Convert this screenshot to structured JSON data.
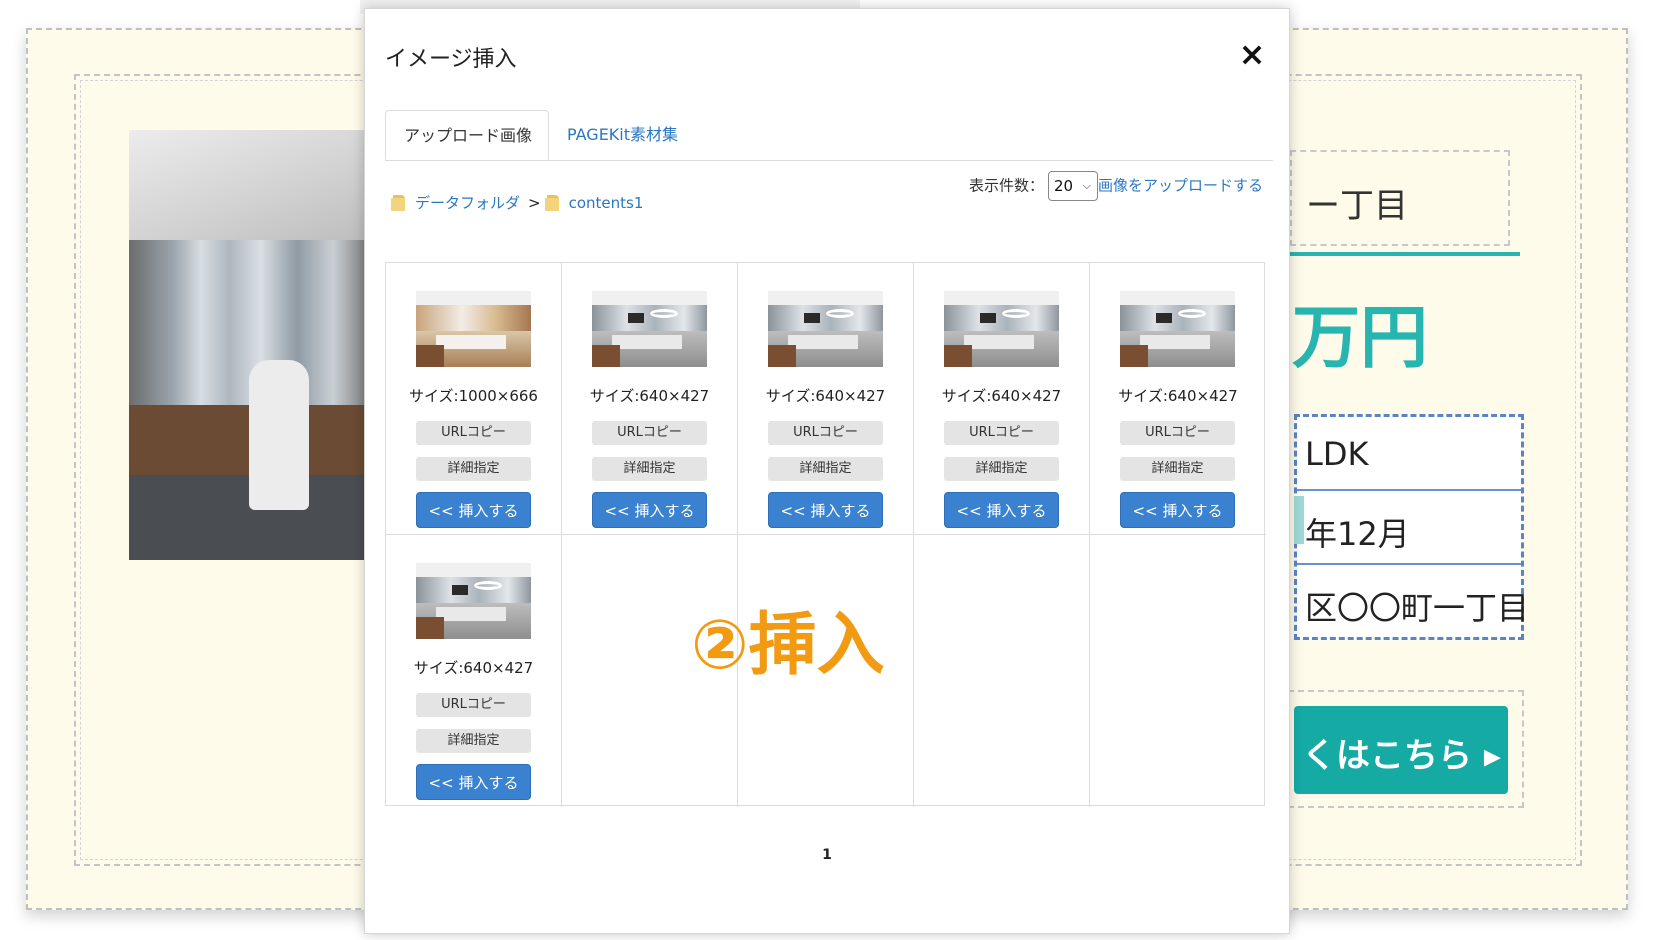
{
  "background_page": {
    "address_partial": "ー丁目",
    "price_partial": "万円",
    "table_rows": [
      "LDK",
      "年12月",
      "区〇〇町一丁目"
    ],
    "button_partial": "くはこちら ▸",
    "teal_color": "#15aaa4"
  },
  "modal": {
    "title": "イメージ挿入",
    "close_icon": "×",
    "tabs": [
      {
        "label": "アップロード画像",
        "active": true
      },
      {
        "label": "PAGEKit素材集",
        "active": false
      }
    ],
    "breadcrumb": {
      "root": "データフォルダ",
      "separator": ">",
      "current": "contents1"
    },
    "count_label": "表示件数：",
    "count_value": "20",
    "upload_link": "画像をアップロードする",
    "images": [
      {
        "size": "サイズ:1000×666",
        "kind": "kitchen"
      },
      {
        "size": "サイズ:640×427",
        "kind": "office"
      },
      {
        "size": "サイズ:640×427",
        "kind": "office"
      },
      {
        "size": "サイズ:640×427",
        "kind": "office"
      },
      {
        "size": "サイズ:640×427",
        "kind": "office"
      },
      {
        "size": "サイズ:640×427",
        "kind": "office"
      }
    ],
    "url_copy_label": "URLコピー",
    "detail_label": "詳細指定",
    "insert_label": "<< 挿入する",
    "page_number": "1"
  },
  "annotation": {
    "text": "②挿入",
    "color": "#f29a12"
  },
  "colors": {
    "link": "#2a77c2",
    "insert_button": "#3a82d0"
  }
}
